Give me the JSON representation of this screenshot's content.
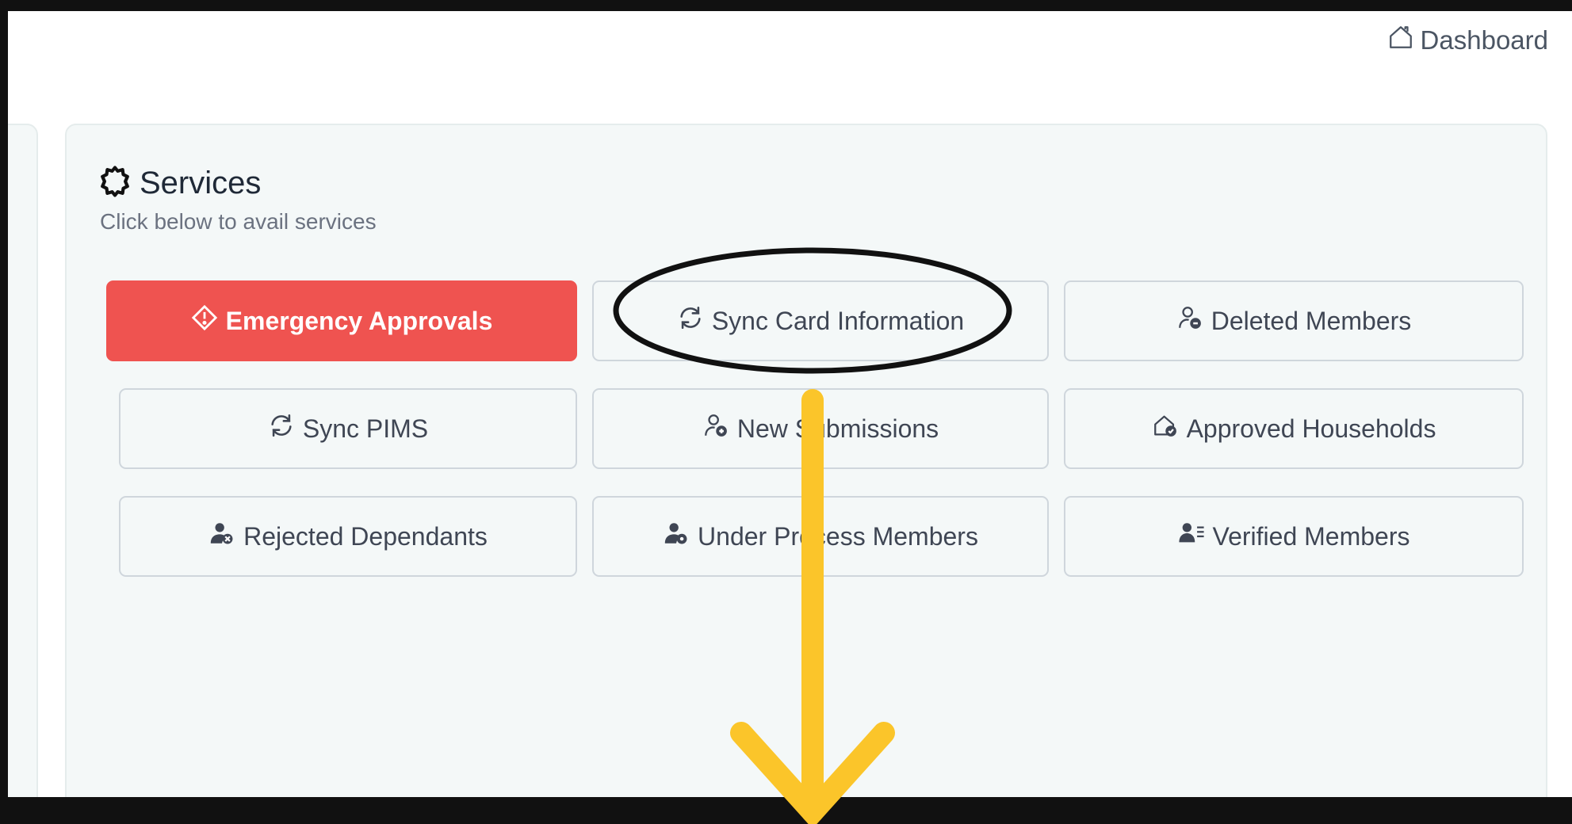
{
  "breadcrumb": {
    "label": "Dashboard",
    "icon": "home-icon"
  },
  "services": {
    "title": "Services",
    "title_icon": "gear-icon",
    "subtitle": "Click below to avail services"
  },
  "buttons": [
    {
      "label": "Emergency Approvals",
      "icon": "alert-diamond-icon",
      "variant": "danger"
    },
    {
      "label": "Sync Card Information",
      "icon": "sync-icon",
      "variant": "outline"
    },
    {
      "label": "Deleted Members",
      "icon": "user-remove-icon",
      "variant": "outline"
    },
    {
      "label": "Sync PIMS",
      "icon": "sync-icon",
      "variant": "outline"
    },
    {
      "label": "New Submissions",
      "icon": "user-add-icon",
      "variant": "outline"
    },
    {
      "label": "Approved Households",
      "icon": "house-check-icon",
      "variant": "outline"
    },
    {
      "label": "Rejected Dependants",
      "icon": "user-x-icon",
      "variant": "outline"
    },
    {
      "label": "Under Process Members",
      "icon": "user-gear-icon",
      "variant": "outline"
    },
    {
      "label": "Verified Members",
      "icon": "user-list-icon",
      "variant": "outline"
    }
  ],
  "colors": {
    "danger": "#ef5350",
    "card_background": "#f4f8f8",
    "annotation_arrow": "#fbc52a",
    "annotation_ellipse": "#111111"
  }
}
